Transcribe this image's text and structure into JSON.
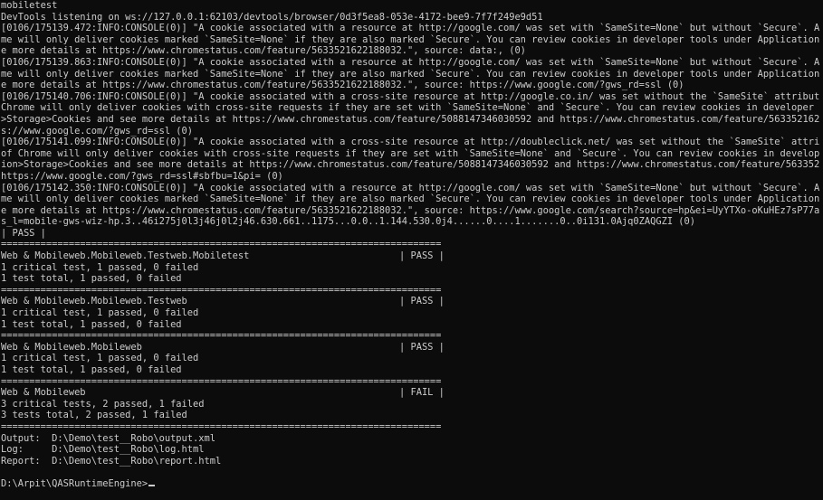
{
  "console": {
    "header": [
      "mobiletest",
      "DevTools listening on ws://127.0.0.1:62103/devtools/browser/0d3f5ea8-053e-4172-bee9-7f7f249e9d51"
    ],
    "logs": [
      "[0106/175139.472:INFO:CONSOLE(0)] \"A cookie associated with a resource at http://google.com/ was set with `SameSite=None` but without `Secure`. A",
      "me will only deliver cookies marked `SameSite=None` if they are also marked `Secure`. You can review cookies in developer tools under Application",
      "e more details at https://www.chromestatus.com/feature/5633521622188032.\", source: data:, (0)",
      "[0106/175139.863:INFO:CONSOLE(0)] \"A cookie associated with a resource at http://google.com/ was set with `SameSite=None` but without `Secure`. A",
      "me will only deliver cookies marked `SameSite=None` if they are also marked `Secure`. You can review cookies in developer tools under Application",
      "e more details at https://www.chromestatus.com/feature/5633521622188032.\", source: https://www.google.com/?gws_rd=ssl (0)",
      "[0106/175140.706:INFO:CONSOLE(0)] \"A cookie associated with a cross-site resource at http://google.co.in/ was set without the `SameSite` attribut",
      "Chrome will only deliver cookies with cross-site requests if they are set with `SameSite=None` and `Secure`. You can review cookies in developer",
      ">Storage>Cookies and see more details at https://www.chromestatus.com/feature/5088147346030592 and https://www.chromestatus.com/feature/563352162",
      "s://www.google.com/?gws_rd=ssl (0)",
      "[0106/175141.099:INFO:CONSOLE(0)] \"A cookie associated with a cross-site resource at http://doubleclick.net/ was set without the `SameSite` attri",
      "of Chrome will only deliver cookies with cross-site requests if they are set with `SameSite=None` and `Secure`. You can review cookies in develop",
      "ion>Storage>Cookies and see more details at https://www.chromestatus.com/feature/5088147346030592 and https://www.chromestatus.com/feature/563352",
      "https://www.google.com/?gws_rd=ssl#sbfbu=1&pi= (0)",
      "[0106/175142.350:INFO:CONSOLE(0)] \"A cookie associated with a resource at http://google.com/ was set with `SameSite=None` but without `Secure`. A",
      "me will only deliver cookies marked `SameSite=None` if they are also marked `Secure`. You can review cookies in developer tools under Application",
      "e more details at https://www.chromestatus.com/feature/5633521622188032.\", source: https://www.google.com/search?source=hp&ei=UyYTXo-oKuHEz7sP77a",
      "s_l=mobile-gws-wiz-hp.3..46i275j0l3j46j0l2j46.630.661..1175...0.0..1.144.530.0j4......0....1.......0..0i131.0Ajq0ZAQGZI (0)",
      "| PASS |"
    ],
    "separator_eq": "==============================================================================",
    "separator_dash": "------------------------------------------------------------------------------",
    "suites": [
      {
        "name": "Web & Mobileweb.Mobileweb.Testweb.Mobiletest",
        "status": "| PASS |",
        "critical": "1 critical test, 1 passed, 0 failed",
        "total": "1 test total, 1 passed, 0 failed"
      },
      {
        "name": "Web & Mobileweb.Mobileweb.Testweb",
        "status": "| PASS |",
        "critical": "1 critical test, 1 passed, 0 failed",
        "total": "1 test total, 1 passed, 0 failed"
      },
      {
        "name": "Web & Mobileweb.Mobileweb",
        "status": "| PASS |",
        "critical": "1 critical test, 1 passed, 0 failed",
        "total": "1 test total, 1 passed, 0 failed"
      },
      {
        "name": "Web & Mobileweb",
        "status": "| FAIL |",
        "critical": "3 critical tests, 2 passed, 1 failed",
        "total": "3 tests total, 2 passed, 1 failed"
      }
    ],
    "outputs": [
      "Output:  D:\\Demo\\test__Robo\\output.xml",
      "Log:     D:\\Demo\\test__Robo\\log.html",
      "Report:  D:\\Demo\\test__Robo\\report.html"
    ],
    "prompt": "D:\\Arpit\\QASRuntimeEngine>"
  },
  "colors": {
    "background": "#0c0c0c",
    "text": "#cccccc"
  }
}
